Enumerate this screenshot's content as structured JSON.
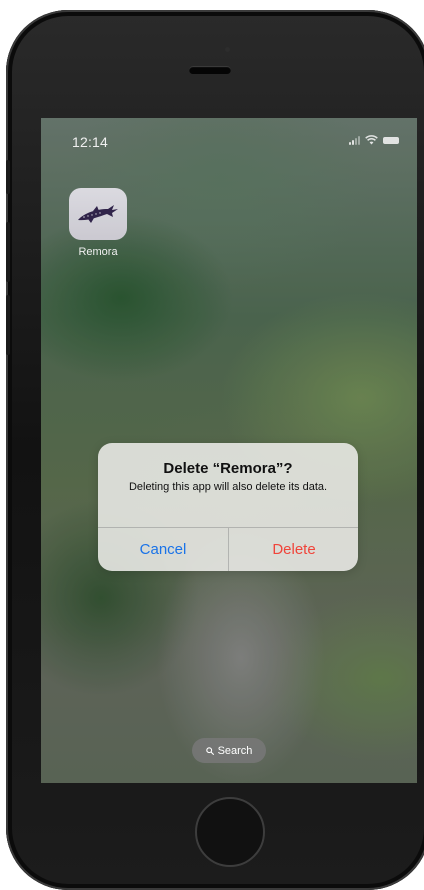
{
  "status_bar": {
    "time": "12:14"
  },
  "home_screen": {
    "apps": [
      {
        "label": "Remora",
        "icon": "remora-fish-icon"
      }
    ],
    "search_label": "Search"
  },
  "alert": {
    "title": "Delete “Remora”?",
    "message": "Deleting this app will also delete its data.",
    "cancel_label": "Cancel",
    "delete_label": "Delete",
    "cancel_color": "#1a73e8",
    "delete_color": "#f0443a"
  }
}
